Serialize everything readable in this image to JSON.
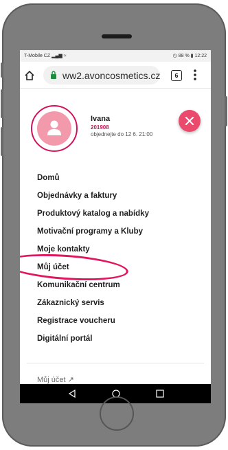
{
  "status_bar": {
    "carrier": "T-Mobile CZ",
    "right_text": "88 %",
    "time": "12:22"
  },
  "browser": {
    "url": "ww2.avoncosmetics.cz",
    "tab_count": "6"
  },
  "profile": {
    "name": "Ivana",
    "id": "201908",
    "deadline": "objednejte do 12 6. 21:00"
  },
  "menu": {
    "items": [
      {
        "label": "Domů"
      },
      {
        "label": "Objednávky a faktury"
      },
      {
        "label": "Produktový katalog a nabídky"
      },
      {
        "label": "Motivační programy a Kluby"
      },
      {
        "label": "Moje kontakty"
      },
      {
        "label": "Můj účet"
      },
      {
        "label": "Komunikační centrum"
      },
      {
        "label": "Zákaznický servis"
      },
      {
        "label": "Registrace voucheru"
      },
      {
        "label": "Digitální portál"
      }
    ],
    "bottom_link": "Můj účet ↗"
  },
  "colors": {
    "accent": "#d1145a",
    "close_button": "#ea4a6c",
    "avatar_bg": "#f29aac"
  }
}
